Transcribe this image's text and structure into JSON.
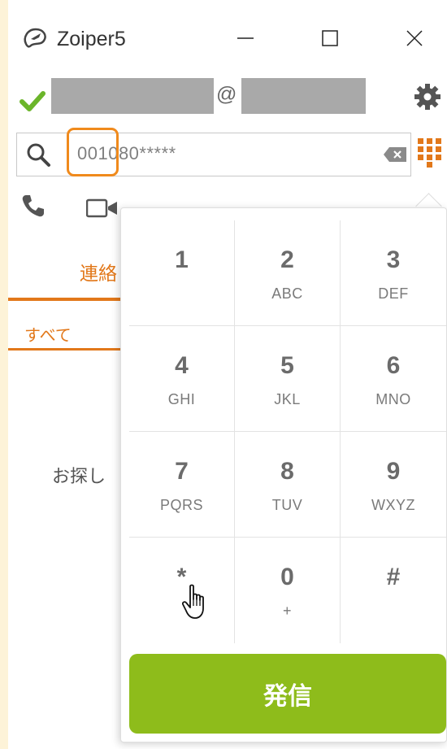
{
  "titlebar": {
    "title": "Zoiper5"
  },
  "account": {
    "at": "@"
  },
  "dialer": {
    "number": "001080*****"
  },
  "tabs": {
    "contacts": "連絡"
  },
  "filters": {
    "all": "すべて"
  },
  "content": {
    "search_hint": "お探し"
  },
  "keypad": {
    "keys": [
      {
        "digit": "1",
        "letters": ""
      },
      {
        "digit": "2",
        "letters": "ABC"
      },
      {
        "digit": "3",
        "letters": "DEF"
      },
      {
        "digit": "4",
        "letters": "GHI"
      },
      {
        "digit": "5",
        "letters": "JKL"
      },
      {
        "digit": "6",
        "letters": "MNO"
      },
      {
        "digit": "7",
        "letters": "PQRS"
      },
      {
        "digit": "8",
        "letters": "TUV"
      },
      {
        "digit": "9",
        "letters": "WXYZ"
      },
      {
        "digit": "*",
        "letters": ""
      },
      {
        "digit": "0",
        "letters": "+"
      },
      {
        "digit": "#",
        "letters": ""
      }
    ],
    "call_label": "発信"
  },
  "colors": {
    "accent": "#e2781a",
    "call": "#8ebc1b",
    "status_ok": "#6bb52a"
  }
}
